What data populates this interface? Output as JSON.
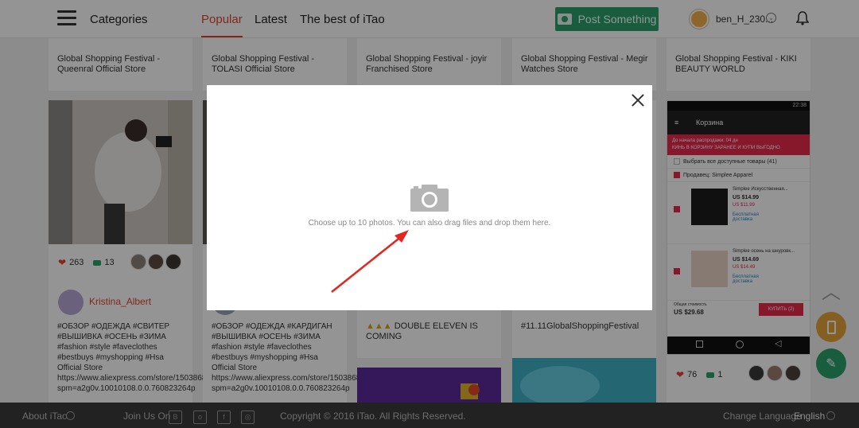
{
  "header": {
    "categories_label": "Categories",
    "tabs": [
      {
        "label": "Popular",
        "active": true
      },
      {
        "label": "Latest",
        "active": false
      },
      {
        "label": "The best of iTao",
        "active": false
      }
    ],
    "post_button": "Post Something",
    "user_name": "ben_H_230..."
  },
  "top_row": [
    "Global Shopping Festival - Queenral Official Store",
    "Global Shopping Festival - TOLASI Official Store",
    "Global Shopping Festival - joyir Franchised Store",
    "Global Shopping Festival - Megir Watches Store",
    "Global Shopping Festival - KIKI BEAUTY WORLD"
  ],
  "post1": {
    "likes": "263",
    "comments": "13",
    "author": "Kristina_Albert",
    "text": "#ОБЗОР #ОДЕЖДА #СВИТЕР #ВЫШИВКА #ОСЕНЬ #ЗИМА #fashion #style #faveclothes #bestbuys #myshopping #Hsa Official Store https://www.aliexpress.com/store/1503868?spm=a2g0v.10010108.0.0.760823264p"
  },
  "post2": {
    "text": "#ОБЗОР #ОДЕЖДА #КАРДИГАН #ВЫШИВКА #ОСЕНЬ #ЗИМА #fashion #style #faveclothes #bestbuys #myshopping #Hsa Official Store https://www.aliexpress.com/store/1503868?spm=a2g0v.10010108.0.0.760823264p"
  },
  "post3": {
    "text": "DOUBLE ELEVEN IS COMING"
  },
  "post4": {
    "text": "#11.11GlobalShoppingFestival"
  },
  "post5": {
    "likes": "76",
    "comments": "1",
    "phone": {
      "status": "22:38",
      "title": "Корзина",
      "promo_line1": "До начала распродажи: 04 дн",
      "promo_line2": "КИНЬ В КОРЗИНУ ЗАРАНЕЕ И КУПИ ВЫГОДНО",
      "select_all": "Выбрать все доступные товары (41)",
      "seller": "Продавец: Simplee Apparel",
      "item1_name": "Simplee Искусственная...",
      "item1_price": "US $14.99",
      "item1_sale": "US $11.99",
      "item1_ship": "Бесплатная доставка",
      "item2_name": "Simplee осень на шнуровк...",
      "item2_price": "US $14.69",
      "item2_sale": "US $14.49",
      "item2_ship": "Бесплатная доставка",
      "total_label": "Общая стоимость",
      "total_value": "US $29.68",
      "buy_button": "КУПИТЬ (2)"
    }
  },
  "modal": {
    "hint": "Choose up to 10 photos. You can also drag files and drop them here."
  },
  "footer": {
    "about": "About iTao",
    "join": "Join Us On",
    "copyright": "Copyright © 2016 iTao. All Rights Reserved.",
    "change_language": "Change Language",
    "language": "English"
  }
}
